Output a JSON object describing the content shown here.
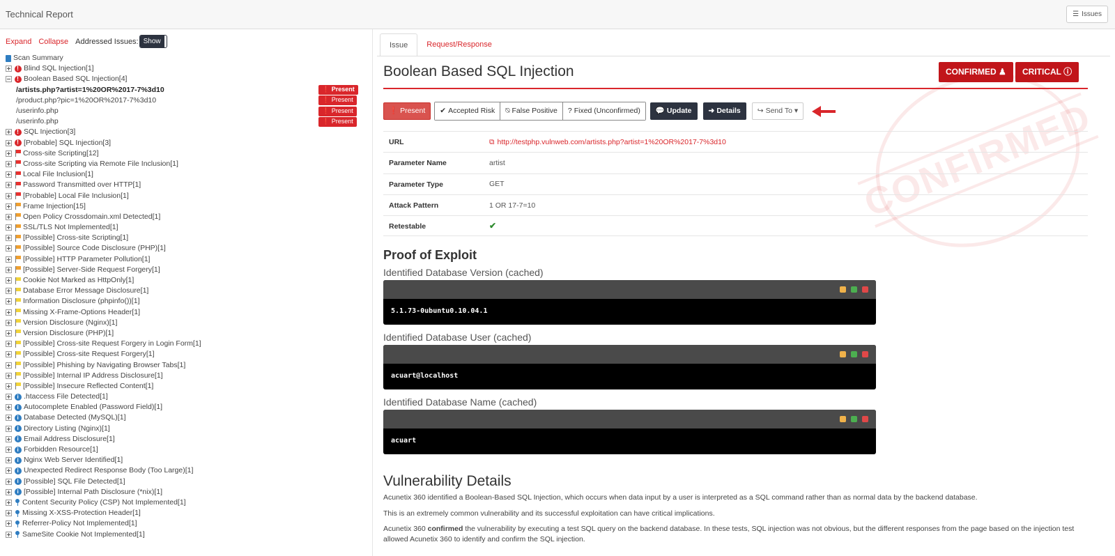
{
  "app": {
    "title": "Technical Report",
    "issues_button": "Issues"
  },
  "controls": {
    "expand": "Expand",
    "collapse": "Collapse",
    "addressed_label": "Addressed Issues:",
    "show": "Show"
  },
  "tree": {
    "scan_summary": "Scan Summary",
    "nodes": [
      {
        "label": "Blind SQL Injection[1]",
        "sev": "crit",
        "expanded": false
      },
      {
        "label": "Boolean Based SQL Injection[4]",
        "sev": "crit",
        "expanded": true
      },
      {
        "child": true,
        "bold": true,
        "label": "/artists.php?artist=1%20OR%2017-7%3d10",
        "status": "Present"
      },
      {
        "child": true,
        "label": "/product.php?pic=1%20OR%2017-7%3d10",
        "status": "Present"
      },
      {
        "child": true,
        "label": "/userinfo.php",
        "status": "Present"
      },
      {
        "child": true,
        "label": "/userinfo.php",
        "status": "Present"
      },
      {
        "label": "SQL Injection[3]",
        "sev": "crit"
      },
      {
        "label": "[Probable] SQL Injection[3]",
        "sev": "crit"
      },
      {
        "label": "Cross-site Scripting[12]",
        "sev": "high"
      },
      {
        "label": "Cross-site Scripting via Remote File Inclusion[1]",
        "sev": "high"
      },
      {
        "label": "Local File Inclusion[1]",
        "sev": "high"
      },
      {
        "label": "Password Transmitted over HTTP[1]",
        "sev": "high"
      },
      {
        "label": "[Probable] Local File Inclusion[1]",
        "sev": "high"
      },
      {
        "label": "Frame Injection[15]",
        "sev": "medium"
      },
      {
        "label": "Open Policy Crossdomain.xml Detected[1]",
        "sev": "medium"
      },
      {
        "label": "SSL/TLS Not Implemented[1]",
        "sev": "medium"
      },
      {
        "label": "[Possible] Cross-site Scripting[1]",
        "sev": "medium"
      },
      {
        "label": "[Possible] Source Code Disclosure (PHP)[1]",
        "sev": "medium"
      },
      {
        "label": "[Possible] HTTP Parameter Pollution[1]",
        "sev": "medium"
      },
      {
        "label": "[Possible] Server-Side Request Forgery[1]",
        "sev": "medium"
      },
      {
        "label": "Cookie Not Marked as HttpOnly[1]",
        "sev": "low"
      },
      {
        "label": "Database Error Message Disclosure[1]",
        "sev": "low"
      },
      {
        "label": "Information Disclosure (phpinfo())[1]",
        "sev": "low"
      },
      {
        "label": "Missing X-Frame-Options Header[1]",
        "sev": "low"
      },
      {
        "label": "Version Disclosure (Nginx)[1]",
        "sev": "low"
      },
      {
        "label": "Version Disclosure (PHP)[1]",
        "sev": "low"
      },
      {
        "label": "[Possible] Cross-site Request Forgery in Login Form[1]",
        "sev": "low"
      },
      {
        "label": "[Possible] Cross-site Request Forgery[1]",
        "sev": "low"
      },
      {
        "label": "[Possible] Phishing by Navigating Browser Tabs[1]",
        "sev": "low"
      },
      {
        "label": "[Possible] Internal IP Address Disclosure[1]",
        "sev": "low"
      },
      {
        "label": "[Possible] Insecure Reflected Content[1]",
        "sev": "low"
      },
      {
        "label": ".htaccess File Detected[1]",
        "sev": "info"
      },
      {
        "label": "Autocomplete Enabled (Password Field)[1]",
        "sev": "info"
      },
      {
        "label": "Database Detected (MySQL)[1]",
        "sev": "info"
      },
      {
        "label": "Directory Listing (Nginx)[1]",
        "sev": "info"
      },
      {
        "label": "Email Address Disclosure[1]",
        "sev": "info"
      },
      {
        "label": "Forbidden Resource[1]",
        "sev": "info"
      },
      {
        "label": "Nginx Web Server Identified[1]",
        "sev": "info"
      },
      {
        "label": "Unexpected Redirect Response Body (Too Large)[1]",
        "sev": "info"
      },
      {
        "label": "[Possible] SQL File Detected[1]",
        "sev": "info"
      },
      {
        "label": "[Possible] Internal Path Disclosure (*nix)[1]",
        "sev": "info"
      },
      {
        "label": "Content Security Policy (CSP) Not Implemented[1]",
        "sev": "best"
      },
      {
        "label": "Missing X-XSS-Protection Header[1]",
        "sev": "best"
      },
      {
        "label": "Referrer-Policy Not Implemented[1]",
        "sev": "best"
      },
      {
        "label": "SameSite Cookie Not Implemented[1]",
        "sev": "best"
      }
    ]
  },
  "tabs": [
    "Issue",
    "Request/Response"
  ],
  "issue": {
    "title": "Boolean Based SQL Injection",
    "confirmed": "CONFIRMED",
    "critical": "CRITICAL",
    "stamp": "CONFIRMED",
    "actions": {
      "present": "Present",
      "accepted": "Accepted Risk",
      "false_positive": "False Positive",
      "fixed": "Fixed (Unconfirmed)",
      "update": "Update",
      "details": "Details",
      "send_to": "Send To"
    },
    "props": [
      {
        "key": "URL",
        "value": "http://testphp.vulnweb.com/artists.php?artist=1%20OR%2017-7%3d10",
        "link": true
      },
      {
        "key": "Parameter Name",
        "value": "artist"
      },
      {
        "key": "Parameter Type",
        "value": "GET"
      },
      {
        "key": "Attack Pattern",
        "value": "1 OR 17-7=10"
      },
      {
        "key": "Retestable",
        "value": "✔",
        "check": true
      }
    ],
    "proof_title": "Proof of Exploit",
    "proofs": [
      {
        "label": "Identified Database Version (cached)",
        "value": "5.1.73-0ubuntu0.10.04.1"
      },
      {
        "label": "Identified Database User (cached)",
        "value": "acuart@localhost"
      },
      {
        "label": "Identified Database Name (cached)",
        "value": "acuart"
      }
    ],
    "vuln_title": "Vulnerability Details",
    "vuln_p1": "Acunetix 360 identified a Boolean-Based SQL Injection, which occurs when data input by a user is interpreted as a SQL command rather than as normal data by the backend database.",
    "vuln_p2": "This is an extremely common vulnerability and its successful exploitation can have critical implications.",
    "vuln_p3_pre": "Acunetix 360 ",
    "vuln_p3_bold": "confirmed",
    "vuln_p3_post": " the vulnerability by executing a test SQL query on the backend database. In these tests, SQL injection was not obvious, but the different responses from the page based on the injection test allowed Acunetix 360 to identify and confirm the SQL injection."
  },
  "colors": {
    "accent": "#d9262b",
    "high_flag": "#e8312f",
    "medium_flag": "#f0a030",
    "low_flag": "#f2d43a"
  }
}
